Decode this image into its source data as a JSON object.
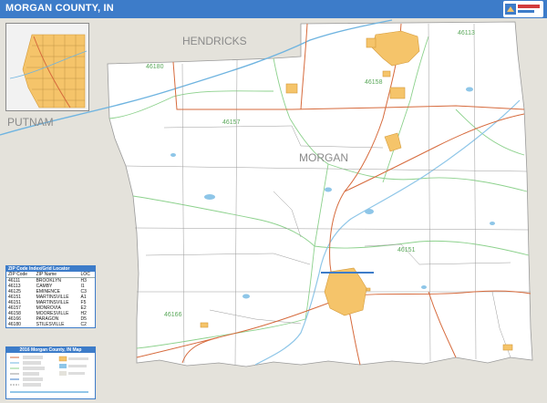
{
  "header": {
    "title": "MORGAN COUNTY, IN"
  },
  "labels": {
    "hendricks": "HENDRICKS",
    "putnam": "PUTNAM",
    "morgan": "MORGAN"
  },
  "zip_labels": [
    "46113",
    "46158",
    "46180",
    "46157",
    "46151",
    "46166"
  ],
  "zip_table": {
    "title": "ZIP Code Index/Grid Locator",
    "columns": [
      "ZIP Code",
      "ZIP Name",
      "LOC"
    ],
    "rows": [
      [
        "46111",
        "BROOKLYN",
        "H3"
      ],
      [
        "46113",
        "CAMBY",
        "I1"
      ],
      [
        "46125",
        "EMINENCE",
        "C3"
      ],
      [
        "46151",
        "MARTINSVILLE",
        "A1"
      ],
      [
        "46151",
        "MARTINSVILLE",
        "F5"
      ],
      [
        "46157",
        "MONROVIA",
        "E2"
      ],
      [
        "46158",
        "MOORESVILLE",
        "H2"
      ],
      [
        "46166",
        "PARAGON",
        "D5"
      ],
      [
        "46180",
        "STILESVILLE",
        "C2"
      ]
    ]
  },
  "legend": {
    "title": "2016 Morgan County, IN Map"
  },
  "colors": {
    "header_bg": "#3d7cc9",
    "county_fill": "#ffffff",
    "outside_fill": "#e4e2db",
    "city_fill": "#f5c46a",
    "road_primary": "#d66a3c",
    "road_minor": "#8a8a8a",
    "zip_boundary": "#8cd18c",
    "water": "#8ec6e8",
    "region_label": "#8a8a8a",
    "zip_label": "#5aa85a"
  },
  "icons": {
    "logo": "map-publisher-logo"
  }
}
